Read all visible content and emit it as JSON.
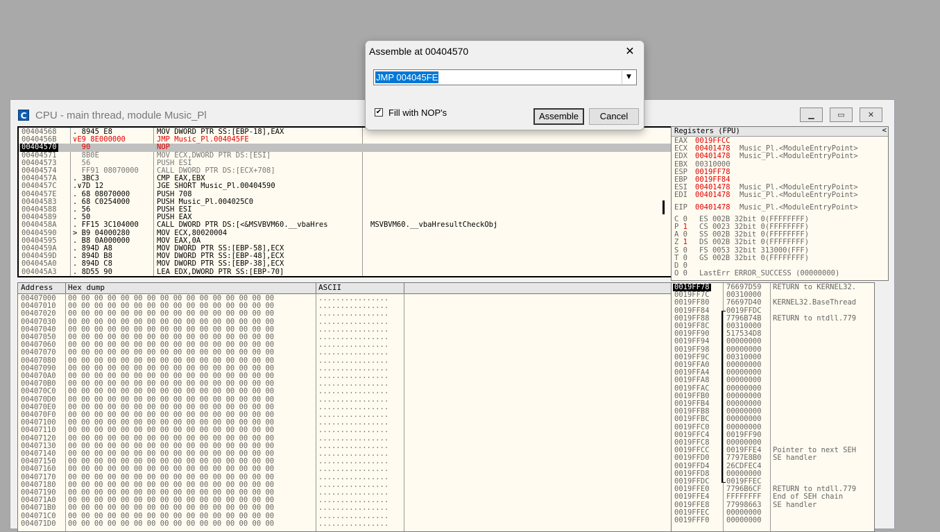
{
  "window": {
    "title": "CPU - main thread, module Music_Pl",
    "icon_letter": "C"
  },
  "disasm": [
    {
      "addr": "00404568",
      "hex": ". 8945 E8",
      "cmd": "MOV DWORD PTR SS:[EBP-18],EAX",
      "cmt": "",
      "style": ""
    },
    {
      "addr": "0040456B",
      "hex": "∨E9 8E000000",
      "cmd": "JMP Music_Pl.004045FE",
      "cmt": "",
      "style": "red"
    },
    {
      "addr": "00404570",
      "hex": "  90",
      "cmd": "NOP",
      "cmt": "",
      "style": "sel"
    },
    {
      "addr": "00404571",
      "hex": "  8B0E",
      "cmd": "MOV ECX,DWORD PTR DS:[ESI]",
      "cmt": "",
      "style": "gray"
    },
    {
      "addr": "00404573",
      "hex": "  56",
      "cmd": "PUSH ESI",
      "cmt": "",
      "style": "gray"
    },
    {
      "addr": "00404574",
      "hex": "  FF91 08070000",
      "cmd": "CALL DWORD PTR DS:[ECX+708]",
      "cmt": "",
      "style": "gray"
    },
    {
      "addr": "0040457A",
      "hex": ". 3BC3",
      "cmd": "CMP EAX,EBX",
      "cmt": "",
      "style": ""
    },
    {
      "addr": "0040457C",
      "hex": ".∨7D 12",
      "cmd": "JGE SHORT Music_Pl.00404590",
      "cmt": "",
      "style": ""
    },
    {
      "addr": "0040457E",
      "hex": ". 68 08070000",
      "cmd": "PUSH 708",
      "cmt": "",
      "style": ""
    },
    {
      "addr": "00404583",
      "hex": ". 68 C0254000",
      "cmd": "PUSH Music_Pl.004025C0",
      "cmt": "",
      "style": ""
    },
    {
      "addr": "00404588",
      "hex": ". 56",
      "cmd": "PUSH ESI",
      "cmt": "",
      "style": ""
    },
    {
      "addr": "00404589",
      "hex": ". 50",
      "cmd": "PUSH EAX",
      "cmt": "",
      "style": ""
    },
    {
      "addr": "0040458A",
      "hex": ". FF15 3C104000",
      "cmd": "CALL DWORD PTR DS:[<&MSVBVM60.__vbaHres",
      "cmt": "MSVBVM60.__vbaHresultCheckObj",
      "style": ""
    },
    {
      "addr": "00404590",
      "hex": "> B9 04000280",
      "cmd": "MOV ECX,80020004",
      "cmt": "",
      "style": ""
    },
    {
      "addr": "00404595",
      "hex": ". B8 0A000000",
      "cmd": "MOV EAX,0A",
      "cmt": "",
      "style": ""
    },
    {
      "addr": "0040459A",
      "hex": ". 894D A8",
      "cmd": "MOV DWORD PTR SS:[EBP-58],ECX",
      "cmt": "",
      "style": ""
    },
    {
      "addr": "0040459D",
      "hex": ". 894D B8",
      "cmd": "MOV DWORD PTR SS:[EBP-48],ECX",
      "cmt": "",
      "style": ""
    },
    {
      "addr": "004045A0",
      "hex": ". 894D C8",
      "cmd": "MOV DWORD PTR SS:[EBP-38],ECX",
      "cmt": "",
      "style": ""
    },
    {
      "addr": "004045A3",
      "hex": ". 8D55 90",
      "cmd": "LEA EDX,DWORD PTR SS:[EBP-70]",
      "cmt": "",
      "style": ""
    }
  ],
  "registers": {
    "header": "Registers (FPU)",
    "lines": [
      {
        "name": "EAX",
        "value": "0019FFCC",
        "extra": "",
        "red": true
      },
      {
        "name": "ECX",
        "value": "00401478",
        "extra": "Music_Pl.<ModuleEntryPoint>",
        "red": true
      },
      {
        "name": "EDX",
        "value": "00401478",
        "extra": "Music_Pl.<ModuleEntryPoint>",
        "red": true
      },
      {
        "name": "EBX",
        "value": "00310000",
        "extra": "",
        "red": false
      },
      {
        "name": "ESP",
        "value": "0019FF78",
        "extra": "",
        "red": true
      },
      {
        "name": "EBP",
        "value": "0019FF84",
        "extra": "",
        "red": true
      },
      {
        "name": "ESI",
        "value": "00401478",
        "extra": "Music_Pl.<ModuleEntryPoint>",
        "red": true
      },
      {
        "name": "EDI",
        "value": "00401478",
        "extra": "Music_Pl.<ModuleEntryPoint>",
        "red": true
      }
    ],
    "eip": {
      "name": "EIP",
      "value": "00401478",
      "extra": "Music_Pl.<ModuleEntryPoint>"
    },
    "flags": [
      {
        "f": "C 0",
        "seg": "ES 002B 32bit 0(FFFFFFFF)",
        "red": false
      },
      {
        "f": "P 1",
        "seg": "CS 0023 32bit 0(FFFFFFFF)",
        "red": true
      },
      {
        "f": "A 0",
        "seg": "SS 002B 32bit 0(FFFFFFFF)",
        "red": false
      },
      {
        "f": "Z 1",
        "seg": "DS 002B 32bit 0(FFFFFFFF)",
        "red": true
      },
      {
        "f": "S 0",
        "seg": "FS 0053 32bit 313000(FFF)",
        "red": false
      },
      {
        "f": "T 0",
        "seg": "GS 002B 32bit 0(FFFFFFFF)",
        "red": false
      },
      {
        "f": "D 0",
        "seg": "",
        "red": false
      },
      {
        "f": "O 0",
        "seg": "LastErr ERROR_SUCCESS (00000000)",
        "red": false
      }
    ]
  },
  "dump": {
    "col_address": "Address",
    "col_hex": "Hex dump",
    "col_ascii": "ASCII",
    "hex_bytes": "00 00 00 00 00 00 00 00 00 00 00 00 00 00 00 00",
    "ascii_text": "................",
    "rows": [
      "00407000",
      "00407010",
      "00407020",
      "00407030",
      "00407040",
      "00407050",
      "00407060",
      "00407070",
      "00407080",
      "00407090",
      "004070A0",
      "004070B0",
      "004070C0",
      "004070D0",
      "004070E0",
      "004070F0",
      "00407100",
      "00407110",
      "00407120",
      "00407130",
      "00407140",
      "00407150",
      "00407160",
      "00407170",
      "00407180",
      "00407190",
      "004071A0",
      "004071B0",
      "004071C0",
      "004071D0"
    ]
  },
  "stack": [
    {
      "addr": "0019FF78",
      "val": "76697D59",
      "cmt": "RETURN to KERNEL32.",
      "sel": true
    },
    {
      "addr": "0019FF7C",
      "val": "00310000",
      "cmt": ""
    },
    {
      "addr": "0019FF80",
      "val": "76697D40",
      "cmt": "KERNEL32.BaseThread"
    },
    {
      "addr": "0019FF84",
      "val": "0019FFDC",
      "cmt": ""
    },
    {
      "addr": "0019FF88",
      "val": "7796B74B",
      "cmt": "RETURN to ntdll.779"
    },
    {
      "addr": "0019FF8C",
      "val": "00310000",
      "cmt": ""
    },
    {
      "addr": "0019FF90",
      "val": "517534D8",
      "cmt": ""
    },
    {
      "addr": "0019FF94",
      "val": "00000000",
      "cmt": ""
    },
    {
      "addr": "0019FF98",
      "val": "00000000",
      "cmt": ""
    },
    {
      "addr": "0019FF9C",
      "val": "00310000",
      "cmt": ""
    },
    {
      "addr": "0019FFA0",
      "val": "00000000",
      "cmt": ""
    },
    {
      "addr": "0019FFA4",
      "val": "00000000",
      "cmt": ""
    },
    {
      "addr": "0019FFA8",
      "val": "00000000",
      "cmt": ""
    },
    {
      "addr": "0019FFAC",
      "val": "00000000",
      "cmt": ""
    },
    {
      "addr": "0019FFB0",
      "val": "00000000",
      "cmt": ""
    },
    {
      "addr": "0019FFB4",
      "val": "00000000",
      "cmt": ""
    },
    {
      "addr": "0019FFB8",
      "val": "00000000",
      "cmt": ""
    },
    {
      "addr": "0019FFBC",
      "val": "00000000",
      "cmt": ""
    },
    {
      "addr": "0019FFC0",
      "val": "00000000",
      "cmt": ""
    },
    {
      "addr": "0019FFC4",
      "val": "0019FF90",
      "cmt": ""
    },
    {
      "addr": "0019FFC8",
      "val": "00000000",
      "cmt": ""
    },
    {
      "addr": "0019FFCC",
      "val": "0019FFE4",
      "cmt": "Pointer to next SEH"
    },
    {
      "addr": "0019FFD0",
      "val": "7797E8B0",
      "cmt": "SE handler"
    },
    {
      "addr": "0019FFD4",
      "val": "26CDFEC4",
      "cmt": ""
    },
    {
      "addr": "0019FFD8",
      "val": "00000000",
      "cmt": ""
    },
    {
      "addr": "0019FFDC",
      "val": "0019FFEC",
      "cmt": ""
    },
    {
      "addr": "0019FFE0",
      "val": "7796B6CF",
      "cmt": "RETURN to ntdll.779"
    },
    {
      "addr": "0019FFE4",
      "val": "FFFFFFFF",
      "cmt": "End of SEH chain"
    },
    {
      "addr": "0019FFE8",
      "val": "77998663",
      "cmt": "SE handler"
    },
    {
      "addr": "0019FFEC",
      "val": "00000000",
      "cmt": ""
    },
    {
      "addr": "0019FFF0",
      "val": "00000000",
      "cmt": ""
    }
  ],
  "dialog": {
    "title": "Assemble at 00404570",
    "command": "JMP 004045FE",
    "fill_nop_label": "Fill with NOP's",
    "fill_nop_checked": true,
    "assemble_label": "Assemble",
    "cancel_label": "Cancel"
  },
  "colors": {
    "accent_red": "#e00000",
    "pane_bg": "#fffbf0",
    "selection": "#0078d7"
  }
}
